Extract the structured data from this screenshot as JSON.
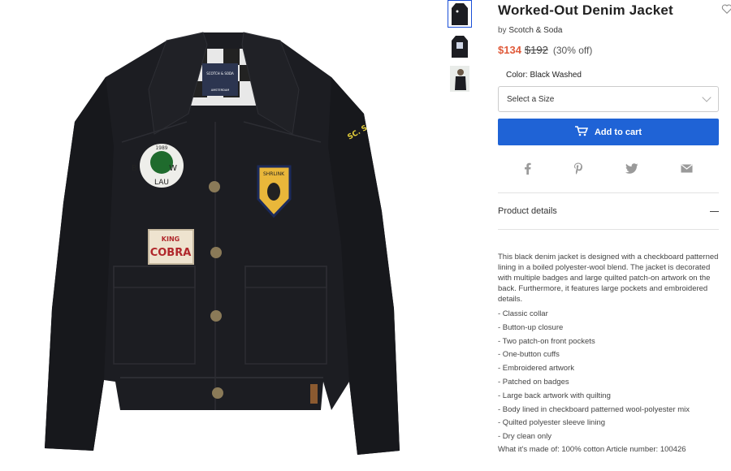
{
  "product": {
    "title": "Worked-Out Denim Jacket",
    "by_prefix": "by",
    "brand": "Scotch & Soda",
    "price_sale": "$134",
    "price_original": "$192",
    "price_discount": "(30% off)",
    "color_label": "Color: Black Washed",
    "size_placeholder": "Select a Size",
    "add_to_cart": "Add to cart"
  },
  "image": {
    "label_top": "SCOTCH & SODA",
    "label_bottom": "AMSTERDAM",
    "patch_skull_top": "1989",
    "patch_skull_letters": "B W",
    "patch_skull_bottom": "LAU",
    "patch_shrink": "SHRLINK",
    "patch_cobra_1": "KING",
    "patch_cobra_2": "COBRA",
    "sleeve_text": "SC. S"
  },
  "details": {
    "heading": "Product details",
    "description": "This black denim jacket is designed with a checkboard patterned lining in a boiled polyester-wool blend. The jacket is decorated with multiple badges and large quilted patch-on artwork on the back. Furthermore, it features large pockets and embroidered details.",
    "bullets": [
      "- Classic collar",
      "- Button-up closure",
      "- Two patch-on front pockets",
      "- One-button cuffs",
      "- Embroidered artwork",
      "- Patched on badges",
      "- Large back artwork with quilting",
      "- Body lined in checkboard patterned wool-polyester mix",
      "- Quilted polyester sleeve lining",
      "- Dry clean only"
    ],
    "materials": "What it's made of: 100% cotton Article number: 100426"
  },
  "colors": {
    "sale": "#e05a3a",
    "cart_button": "#1f63d6",
    "thumb_active_border": "#1a4fd8",
    "denim": "#1c1d22"
  },
  "icons": [
    "heart-icon",
    "cart-icon",
    "facebook-icon",
    "pinterest-icon",
    "twitter-icon",
    "email-icon",
    "minus-icon",
    "chevron-down-icon"
  ]
}
